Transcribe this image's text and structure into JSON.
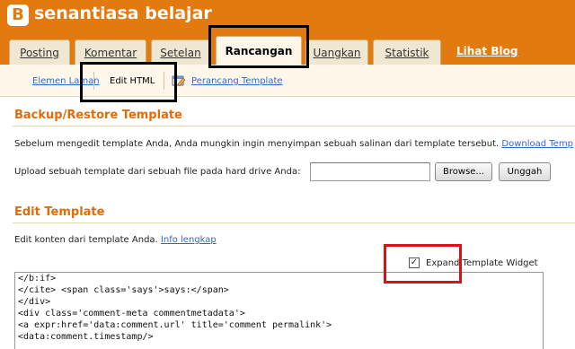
{
  "header": {
    "title": "senantiasa belajar",
    "logo_letter": "B",
    "brand_color": "#e37a0f"
  },
  "tabs": [
    {
      "label": "Posting",
      "active": false
    },
    {
      "label": "Komentar",
      "active": false
    },
    {
      "label": "Setelan",
      "active": false
    },
    {
      "label": "Rancangan",
      "active": true
    },
    {
      "label": "Uangkan",
      "active": false
    },
    {
      "label": "Statistik",
      "active": false
    }
  ],
  "view_blog_link": "Lihat Blog",
  "subnav": {
    "items": [
      {
        "label": "Elemen Laman",
        "active": false
      },
      {
        "label": "Edit HTML",
        "active": true
      },
      {
        "label": "Perancang Template",
        "active": false
      }
    ]
  },
  "backup": {
    "title": "Backup/Restore Template",
    "description": "Sebelum mengedit template Anda, Anda mungkin ingin menyimpan sebuah salinan dari template tersebut.",
    "download_link": "Download Temp",
    "upload_label": "Upload sebuah template dari sebuah file pada hard drive Anda:",
    "browse_button": "Browse...",
    "upload_button": "Unggah"
  },
  "edit": {
    "title": "Edit Template",
    "description": "Edit konten dari template Anda.",
    "info_link": "Info lengkap",
    "expand_label": "Expand Template Widget",
    "expand_checked": true,
    "code_lines": [
      "</b:if>",
      "</cite> <span class='says'>says:</span>",
      "</div>",
      "<div class='comment-meta commentmetadata'>",
      "<a expr:href='data:comment.url' title='comment permalink'>",
      "<data:comment.timestamp/>"
    ]
  },
  "annotation_color": "#000000",
  "highlight_color": "#dd1111"
}
